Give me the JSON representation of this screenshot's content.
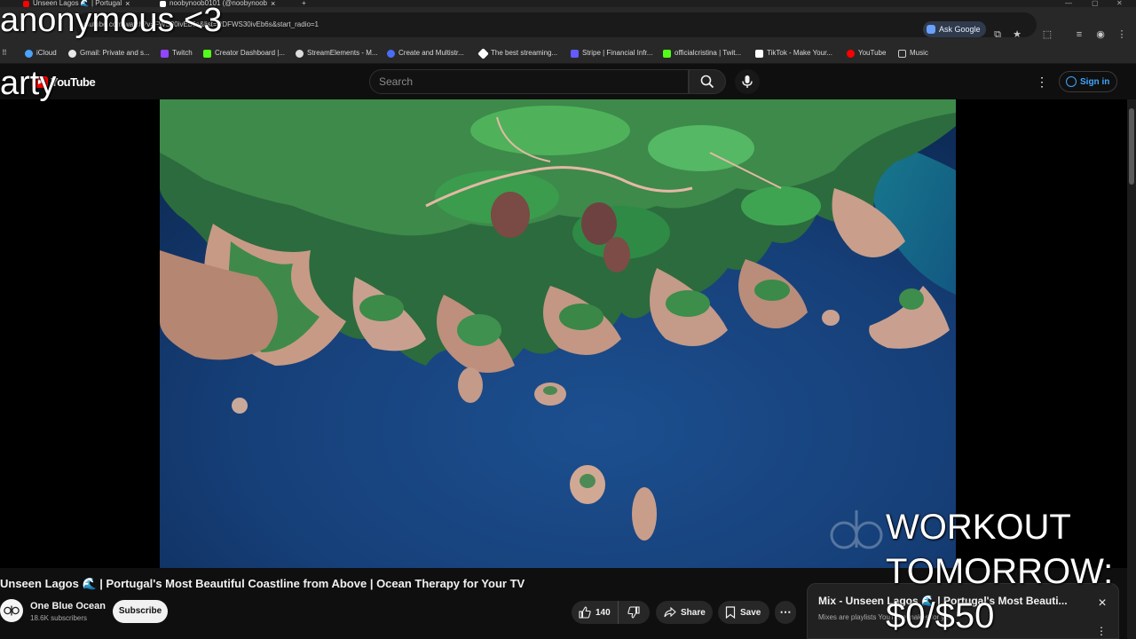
{
  "browser": {
    "tabs": [
      {
        "label": "Unseen Lagos 🌊 | Portugal",
        "favicon_color": "#ff0000"
      },
      {
        "label": "noobynoob0101 (@noobynoob",
        "favicon_color": "#ffffff"
      }
    ],
    "url": "youtube.com/watch?v=FWS30ivEb6s&list=RDFWS30ivEb6s&start_radio=1",
    "ask_google_label": "Ask Google",
    "bookmarks": [
      {
        "label": "iCloud",
        "icon_color": "#4aa3ff"
      },
      {
        "label": "Gmail: Private and s...",
        "icon_color": "#e8e8e8"
      },
      {
        "label": "Twitch",
        "icon_color": "#9146ff"
      },
      {
        "label": "Creator Dashboard |...",
        "icon_color": "#53fc18"
      },
      {
        "label": "StreamElements - M...",
        "icon_color": "#dddddd"
      },
      {
        "label": "Create and Multistr...",
        "icon_color": "#4a6cf7"
      },
      {
        "label": "The best streaming...",
        "icon_color": "#ffffff"
      },
      {
        "label": "Stripe | Financial Infr...",
        "icon_color": "#635bff"
      },
      {
        "label": "officialcristina | Twit...",
        "icon_color": "#53fc18"
      },
      {
        "label": "TikTok - Make Your...",
        "icon_color": "#ffffff"
      },
      {
        "label": "YouTube",
        "icon_color": "#ff0000"
      },
      {
        "label": "Music",
        "icon_color": "#cccccc"
      }
    ]
  },
  "youtube": {
    "logo_text": "YouTube",
    "search_placeholder": "Search",
    "sign_in_label": "Sign in",
    "video_title": "Unseen Lagos 🌊 | Portugal's Most Beautiful Coastline from Above | Ocean Therapy for Your TV",
    "channel_name": "One Blue Ocean",
    "subscribers": "18.6K subscribers",
    "subscribe_label": "Subscribe",
    "like_count": "140",
    "share_label": "Share",
    "save_label": "Save",
    "accent_red": "#ff0000",
    "accent_blue": "#3ea6ff"
  },
  "mix_panel": {
    "title": "Mix - Unseen Lagos 🌊 | Portugal's Most Beauti...",
    "subtitle": "Mixes are playlists YouTube makes for you"
  },
  "stream_overlay": {
    "line_top_1": "anonymous <3",
    "line_top_2": "arty",
    "workout_1": "WORKOUT",
    "workout_2": "TOMORROW:",
    "workout_3": "$0/$50"
  }
}
